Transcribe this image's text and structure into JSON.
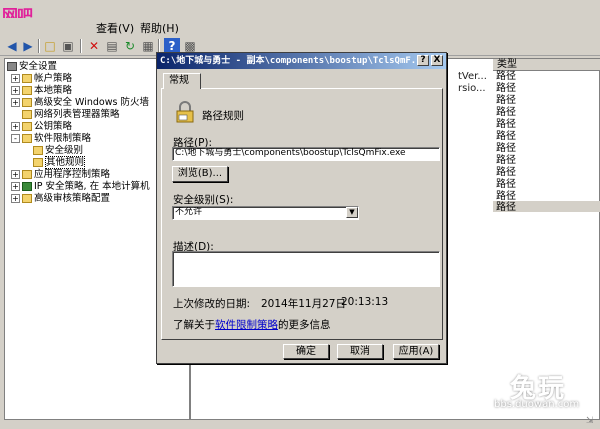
{
  "watermark": {
    "logo_top": "网吧",
    "logo_num": "5836",
    "brand": "兔玩",
    "url": "bbs.duowan.com"
  },
  "menubar": {
    "view": "查看(V)",
    "help": "帮助(H)"
  },
  "tree": {
    "items": [
      {
        "label": "安全设置",
        "level": 0,
        "expand": "-"
      },
      {
        "label": "帐户策略",
        "level": 1,
        "expand": "+"
      },
      {
        "label": "本地策略",
        "level": 1,
        "expand": "+"
      },
      {
        "label": "高级安全 Windows 防火墙",
        "level": 1,
        "expand": "+"
      },
      {
        "label": "网络列表管理器策略",
        "level": 1,
        "expand": ""
      },
      {
        "label": "公钥策略",
        "level": 1,
        "expand": "+"
      },
      {
        "label": "软件限制策略",
        "level": 1,
        "expand": "-"
      },
      {
        "label": "安全级别",
        "level": 2,
        "expand": ""
      },
      {
        "label": "其他规则",
        "level": 2,
        "expand": "",
        "selected": true
      },
      {
        "label": "应用程序控制策略",
        "level": 1,
        "expand": "+"
      },
      {
        "label": "IP 安全策略, 在 本地计算机",
        "level": 1,
        "expand": "+"
      },
      {
        "label": "高级审核策略配置",
        "level": 1,
        "expand": "+"
      }
    ]
  },
  "list": {
    "column_type": "类型",
    "partial": [
      "tVer...",
      "rsio..."
    ],
    "rows": [
      "路径",
      "路径",
      "路径",
      "路径",
      "路径",
      "路径",
      "路径",
      "路径",
      "路径",
      "路径",
      "路径",
      "路径"
    ]
  },
  "dialog": {
    "title": "C:\\地下城与勇士 - 副本\\components\\boostup\\TclsQmF...",
    "help_btn": "?",
    "close_btn": "X",
    "tab": "常规",
    "rule_label": "路径规则",
    "path_label": "路径(P):",
    "path_value": "C:\\地下城与勇士\\components\\boostup\\TclsQmFix.exe",
    "browse_btn": "浏览(B)...",
    "level_label": "安全级别(S):",
    "level_value": "不允许",
    "desc_label": "描述(D):",
    "desc_value": "",
    "modified_label": "上次修改的日期:",
    "modified_date": "2014年11月27日",
    "modified_time": "20:13:13",
    "learn_prefix": "了解关于",
    "learn_link": "软件限制策略",
    "learn_suffix": "的更多信息",
    "ok_btn": "确定",
    "cancel_btn": "取消",
    "apply_btn": "应用(A)"
  }
}
